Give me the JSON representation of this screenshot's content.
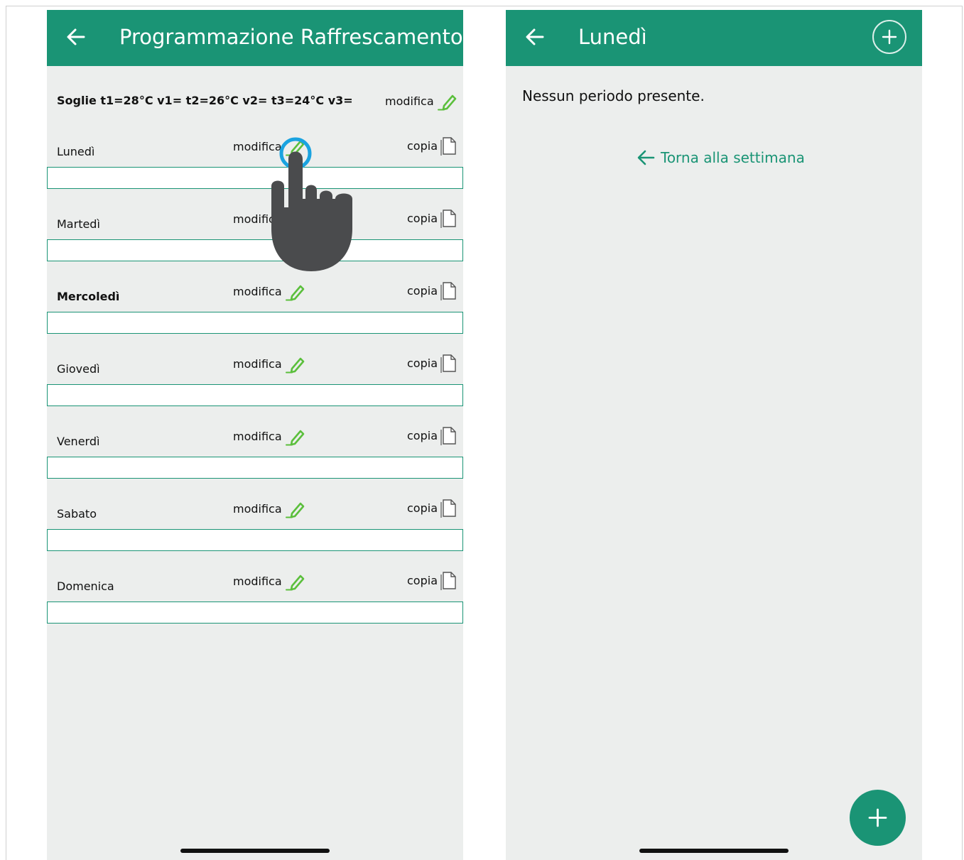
{
  "left": {
    "title": "Programmazione Raffrescamento",
    "thresholds_text": "Soglie t1=28°C v1= t2=26°C v2= t3=24°C v3=",
    "thresholds_edit_label": "modifica",
    "edit_label": "modifica",
    "copy_label": "copia",
    "days": [
      {
        "label": "Lunedì",
        "bold": false
      },
      {
        "label": "Martedì",
        "bold": false
      },
      {
        "label": "Mercoledì",
        "bold": true
      },
      {
        "label": "Giovedì",
        "bold": false
      },
      {
        "label": "Venerdì",
        "bold": false
      },
      {
        "label": "Sabato",
        "bold": false
      },
      {
        "label": "Domenica",
        "bold": false
      }
    ]
  },
  "right": {
    "title": "Lunedì",
    "empty_message": "Nessun periodo presente.",
    "back_link": "Torna alla settimana"
  },
  "colors": {
    "header": "#1a9475",
    "pencil": "#5bbf3c",
    "tap_ring": "#1aa3e0",
    "hand": "#4a4b4d"
  },
  "icons": [
    "back-arrow-icon",
    "pencil-icon",
    "copy-icon",
    "plus-icon",
    "hand-pointer-icon"
  ]
}
